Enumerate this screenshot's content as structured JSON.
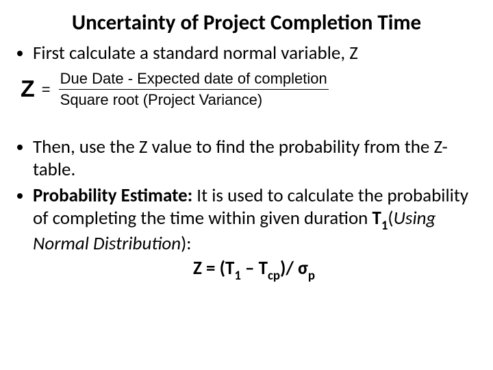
{
  "title": "Uncertainty of Project Completion Time",
  "bullet1": "First calculate a standard normal variable, Z",
  "formula": {
    "lhs": "Z",
    "eq": "=",
    "numerator": "Due Date - Expected date of completion",
    "denominator": "Square root (Project Variance)"
  },
  "bullet2": "Then, use the Z value to find the probability from the Z- table.",
  "bullet3_bold": "Probability Estimate:",
  "bullet3_rest_a": " It is used to calculate the probability of completing the time within given duration ",
  "bullet3_T1": "T",
  "bullet3_T1_sub": "1",
  "bullet3_rest_b": "(",
  "bullet3_italic": "Using Normal Distribution",
  "bullet3_rest_c": "):",
  "eq_Z": "Z = (T",
  "eq_sub1": "1",
  "eq_mid": " – T",
  "eq_subcp": "cp",
  "eq_div": ")/ σ",
  "eq_subp": "p"
}
